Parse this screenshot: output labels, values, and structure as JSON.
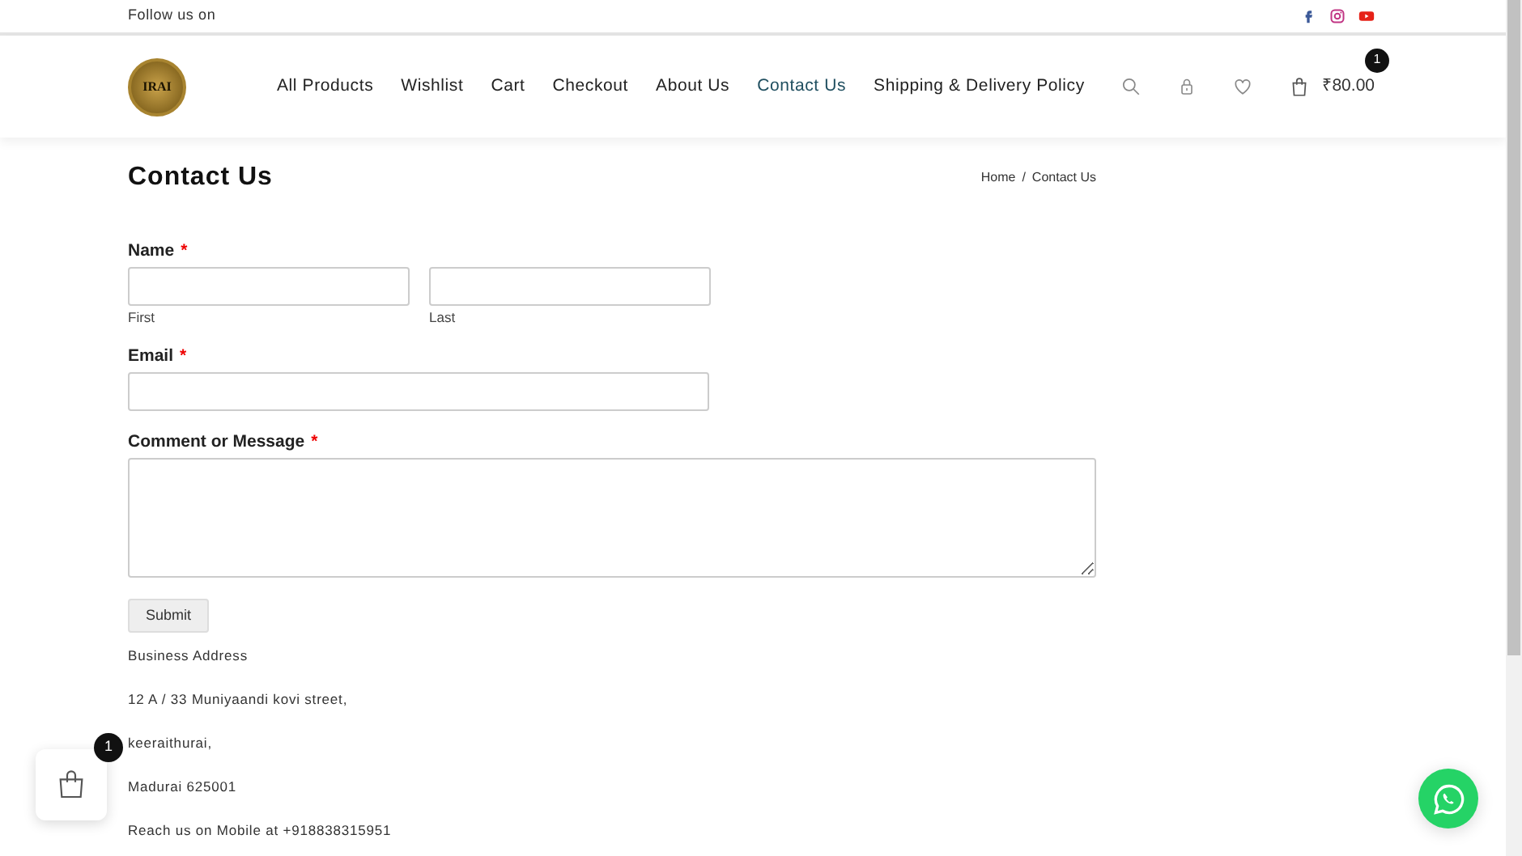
{
  "topbar": {
    "text": "Follow us on",
    "socials": [
      {
        "kind": "facebook",
        "color": "#3b5998"
      },
      {
        "kind": "instagram",
        "color": "#c13584"
      },
      {
        "kind": "youtube",
        "color": "#e62117"
      }
    ]
  },
  "header": {
    "logo_text": "IRAI",
    "nav": [
      {
        "label": "All Products",
        "selected": false
      },
      {
        "label": "Wishlist",
        "selected": false
      },
      {
        "label": "Cart",
        "selected": false
      },
      {
        "label": "Checkout",
        "selected": false
      },
      {
        "label": "About Us",
        "selected": false
      },
      {
        "label": "Contact Us",
        "selected": true
      },
      {
        "label": "Shipping & Delivery Policy",
        "selected": false
      }
    ],
    "cart_count": "1",
    "cart_total": "₹80.00"
  },
  "page_title": "Contact Us",
  "breadcrumb": [
    "Home",
    "Contact Us"
  ],
  "breadcrumb_separator": "/",
  "form": {
    "fields": [
      {
        "kind": "name",
        "label": "Name",
        "required_mark": "*",
        "sublabels": [
          "First",
          "Last"
        ]
      },
      {
        "kind": "email",
        "label": "Email",
        "required_mark": "*"
      },
      {
        "kind": "textarea",
        "label": "Comment or Message",
        "required_mark": "*"
      }
    ],
    "submit": "Submit"
  },
  "address": [
    "Business Address",
    "12 A / 33 Muniyaandi kovi street,",
    "keeraithurai,",
    "Madurai 625001",
    "Reach us on Mobile at +918838315951"
  ],
  "floating_cart": {
    "count": "1"
  }
}
